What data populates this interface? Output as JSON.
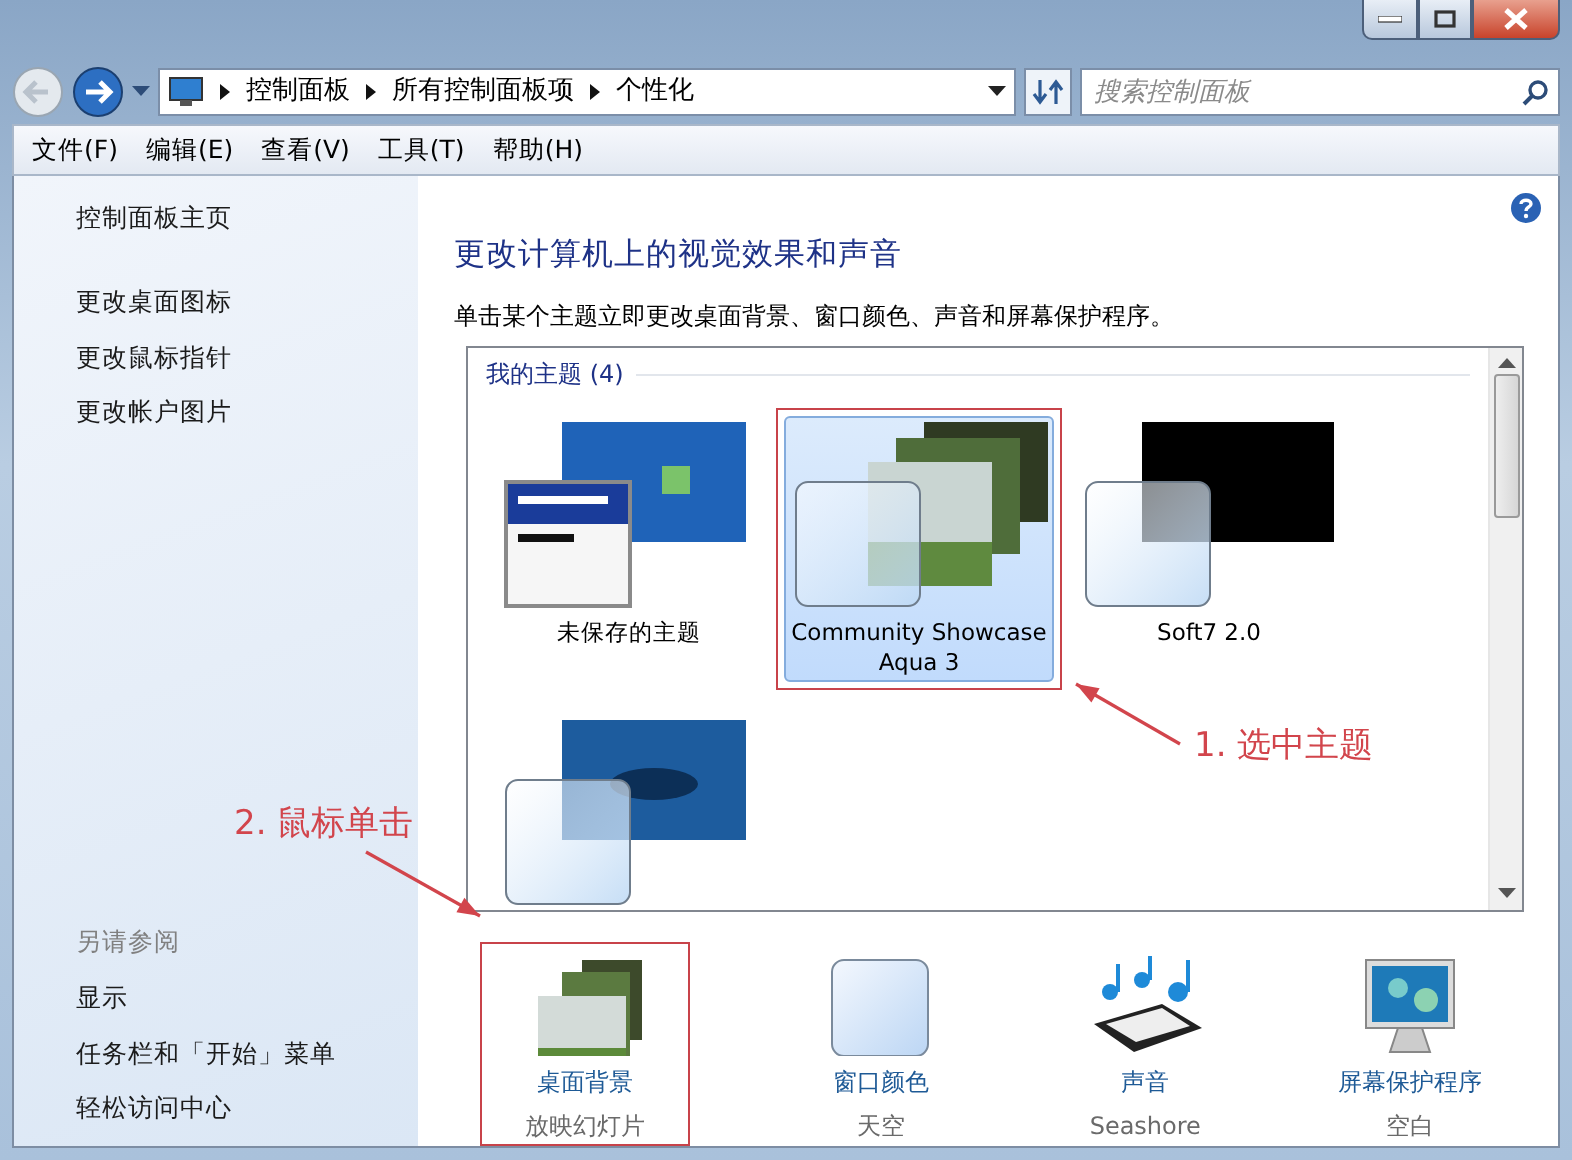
{
  "address_bar": {
    "breadcrumbs": [
      "控制面板",
      "所有控制面板项",
      "个性化"
    ]
  },
  "search": {
    "placeholder": "搜索控制面板"
  },
  "menu": [
    "文件(F)",
    "编辑(E)",
    "查看(V)",
    "工具(T)",
    "帮助(H)"
  ],
  "sidebar": {
    "links": [
      "控制面板主页",
      "更改桌面图标",
      "更改鼠标指针",
      "更改帐户图片"
    ],
    "see_also_title": "另请参阅",
    "see_also": [
      "显示",
      "任务栏和「开始」菜单",
      "轻松访问中心"
    ]
  },
  "content": {
    "title": "更改计算机上的视觉效果和声音",
    "description": "单击某个主题立即更改桌面背景、窗口颜色、声音和屏幕保护程序。",
    "themes": {
      "group": "我的主题 (4)",
      "items": [
        {
          "kind": "unsaved",
          "label": "未保存的主题",
          "selected": false,
          "annotated": false
        },
        {
          "kind": "showcase",
          "label": "Community Showcase Aqua 3",
          "selected": true,
          "annotated": true
        },
        {
          "kind": "dark",
          "label": "Soft7 2.0",
          "selected": false,
          "annotated": false
        },
        {
          "kind": "water",
          "selected": false,
          "annotated": false
        }
      ]
    },
    "settings": [
      {
        "kind": "background",
        "label": "桌面背景",
        "value": "放映幻灯片",
        "annotated": true
      },
      {
        "kind": "color",
        "label": "窗口颜色",
        "value": "天空",
        "annotated": false
      },
      {
        "kind": "sound",
        "label": "声音",
        "value": "Seashore",
        "annotated": false
      },
      {
        "kind": "screensaver",
        "label": "屏幕保护程序",
        "value": "空白",
        "annotated": false
      }
    ]
  },
  "annotations": [
    {
      "text": "1. 选中主题"
    },
    {
      "text": "2. 鼠标单击"
    }
  ]
}
